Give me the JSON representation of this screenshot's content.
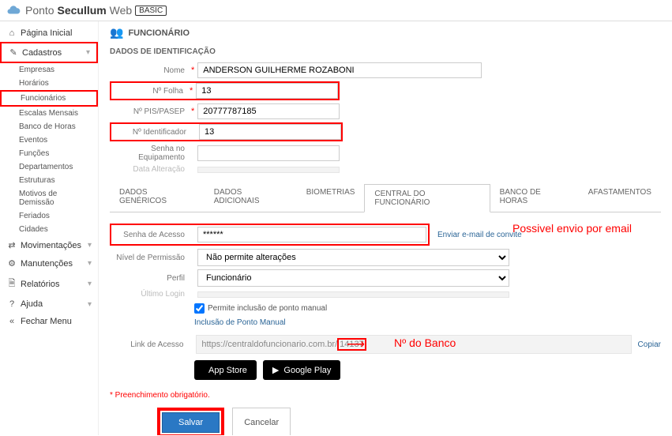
{
  "header": {
    "brand1": "Ponto ",
    "brand2": "Secullum",
    "brand3": " Web",
    "badge": "BASIC"
  },
  "sidebar": {
    "home": "Página Inicial",
    "cadastros": "Cadastros",
    "subs": {
      "empresas": "Empresas",
      "horarios": "Horários",
      "funcionarios": "Funcionários",
      "escalas": "Escalas Mensais",
      "banco": "Banco de Horas",
      "eventos": "Eventos",
      "funcoes": "Funções",
      "departamentos": "Departamentos",
      "estruturas": "Estruturas",
      "motivos": "Motivos de Demissão",
      "feriados": "Feriados",
      "cidades": "Cidades"
    },
    "movimentacoes": "Movimentações",
    "manutencoes": "Manutenções",
    "relatorios": "Relatórios",
    "ajuda": "Ajuda",
    "fechar": "Fechar Menu"
  },
  "main": {
    "title": "FUNCIONÁRIO",
    "sect1": "DADOS DE IDENTIFICAÇÃO",
    "labels": {
      "nome": "Nome",
      "folha": "Nº Folha",
      "pis": "Nº PIS/PASEP",
      "ident": "Nº Identificador",
      "senhaEquip": "Senha no Equipamento",
      "dataAlt": "Data Alteração"
    },
    "values": {
      "nome": "ANDERSON GUILHERME ROZABONI",
      "folha": "13",
      "pis": "20777787185",
      "ident": "13",
      "senhaEquip": "",
      "dataAlt": ""
    },
    "tabs": {
      "t1": "DADOS GENÉRICOS",
      "t2": "DADOS ADICIONAIS",
      "t3": "BIOMETRIAS",
      "t4": "CENTRAL DO FUNCIONÁRIO",
      "t5": "BANCO DE HORAS",
      "t6": "AFASTAMENTOS"
    },
    "central": {
      "senhaLabel": "Senha de Acesso",
      "senhaValue": "******",
      "enviarEmail": "Enviar e-mail de convite",
      "nivelLabel": "Nível de Permissão",
      "nivelValue": "Não permite alterações",
      "perfilLabel": "Perfil",
      "perfilValue": "Funcionário",
      "ultimoLabel": "Último Login",
      "ultimoValue": "",
      "chkLabel": "Permite inclusão de ponto manual",
      "linkInc": "Inclusão de Ponto Manual",
      "linkAcLabel": "Link de Acesso",
      "linkAcPart1": "https://centraldofuncionario.com.br/",
      "linkAcPart2": "14137",
      "copiar": "Copiar",
      "appstore": "App Store",
      "gplay": "Google Play"
    },
    "reqnote": "* Preenchimento obrigatório.",
    "save": "Salvar",
    "cancel": "Cancelar"
  },
  "annotations": {
    "a1": "Possivel envio por email",
    "a2": "Nº do Banco"
  }
}
